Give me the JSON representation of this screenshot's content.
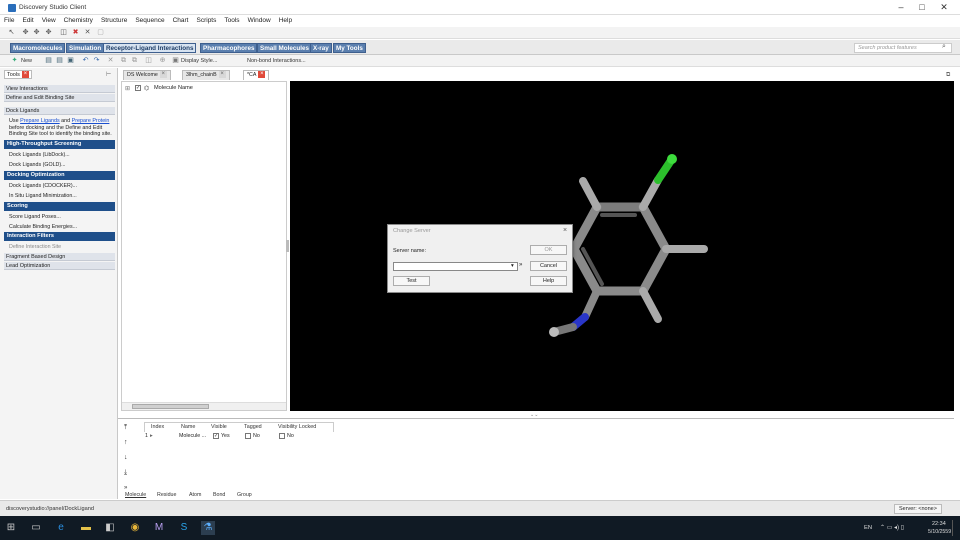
{
  "window": {
    "title": "Discovery Studio Client"
  },
  "menu": [
    "File",
    "Edit",
    "View",
    "Chemistry",
    "Structure",
    "Sequence",
    "Chart",
    "Scripts",
    "Tools",
    "Window",
    "Help"
  ],
  "category_tabs": [
    {
      "label": "Macromolecules"
    },
    {
      "label": "Simulation"
    },
    {
      "label": "Receptor-Ligand Interactions"
    },
    {
      "label": "Pharmacophores"
    },
    {
      "label": "Small Molecules"
    },
    {
      "label": "X-ray"
    },
    {
      "label": "My Tools"
    }
  ],
  "search_placeholder": "Search product features",
  "toolbar2": {
    "new_label": "New",
    "display_style": "Display Style...",
    "nonbond": "Non-bond Interactions..."
  },
  "tools_panel": {
    "tab_label": "Tools",
    "sections_top": [
      "View Interactions",
      "Define and Edit Binding Site",
      "Dock Ligands"
    ],
    "dock_desc_1": "Use",
    "dock_link_1": "Prepare Ligands",
    "dock_desc_2": "and",
    "dock_link_2": "Prepare Protein",
    "dock_desc_3": "before docking and the Define and Edit",
    "dock_desc_4": "Binding Site tool to identify the binding site.",
    "hts_head": "High-Throughput Screening",
    "hts_items": [
      "Dock Ligands (LibDock)...",
      "Dock Ligands (GOLD)..."
    ],
    "dopt_head": "Docking Optimization",
    "dopt_items": [
      "Dock Ligands (CDOCKER)...",
      "In Situ Ligand Minimization..."
    ],
    "score_head": "Scoring",
    "score_items": [
      "Score Ligand Poses...",
      "Calculate Binding Energies..."
    ],
    "if_head": "Interaction Filters",
    "if_items": [
      "Define Interaction Site"
    ],
    "sections_bottom": [
      "Fragment Based Design",
      "Lead Optimization"
    ]
  },
  "doc_tabs": [
    {
      "label": "DS Welcome"
    },
    {
      "label": "3lhm_chainB"
    },
    {
      "label": "*CA"
    }
  ],
  "tree": {
    "root_label": "Molecule Name"
  },
  "dialog": {
    "title": "Change Server",
    "server_label": "Server name:",
    "server_value": "",
    "more": "»",
    "ok": "OK",
    "cancel": "Cancel",
    "test": "Test",
    "help": "Help"
  },
  "table": {
    "columns": [
      "Index",
      "Name",
      "Visible",
      "Tagged",
      "Visibility Locked"
    ],
    "rows": [
      {
        "index": "1",
        "name": "Molecule ...",
        "visible": "Yes",
        "tagged": "No",
        "locked": "No"
      }
    ]
  },
  "bottom_tabs": [
    "Molecule",
    "Residue",
    "Atom",
    "Bond",
    "Group"
  ],
  "status": {
    "path": "discoverystudio://panel/DockLigand",
    "server": "Server: <none>"
  },
  "taskbar": {
    "lang": "EN",
    "time": "22:34",
    "date": "5/10/2559"
  }
}
